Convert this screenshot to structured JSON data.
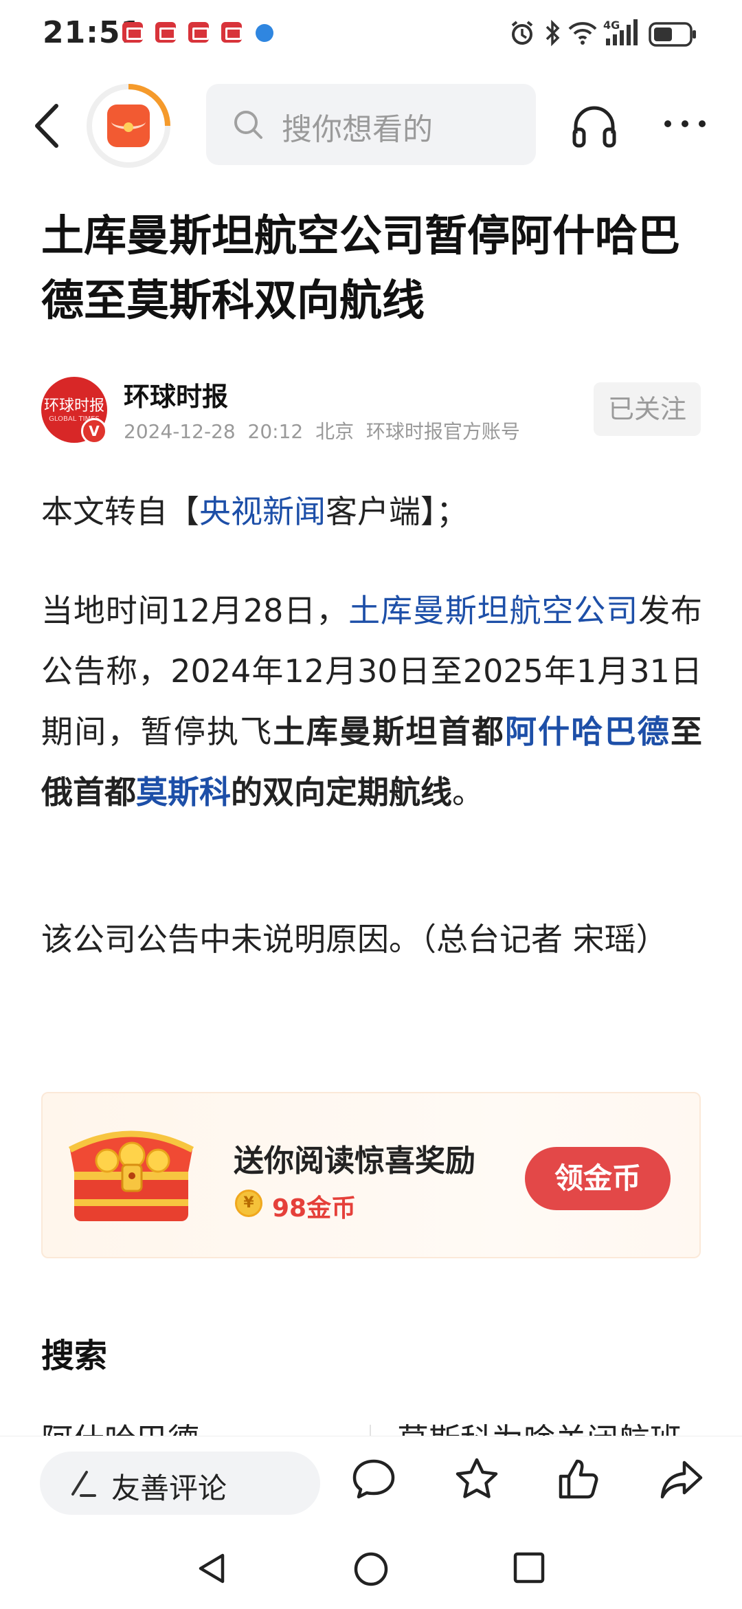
{
  "status_bar": {
    "time": "21:51",
    "icons": [
      "red-app-icon",
      "red-app-icon",
      "red-app-icon",
      "red-app-icon",
      "blue-app-icon",
      "alarm-icon",
      "bluetooth-icon",
      "wifi-icon",
      "signal-4g-icon",
      "battery-icon"
    ]
  },
  "nav": {
    "search_placeholder": "搜你想看的",
    "icons": [
      "back-icon",
      "red-packet-avatar",
      "search-icon",
      "headphones-icon",
      "more-icon"
    ]
  },
  "article": {
    "title": "土库曼斯坦航空公司暂停阿什哈巴德至莫斯科双向航线",
    "author": {
      "name": "环球时报",
      "logo_text": "环球时报",
      "logo_subtext": "GLOBAL TIMES",
      "verified_badge": "V",
      "date": "2024-12-28",
      "time": "20:12",
      "location": "北京",
      "account_type": "环球时报官方账号",
      "follow_label": "已关注"
    },
    "p1": {
      "prefix": "本文转自【",
      "link": "央视新闻",
      "suffix": "客户端】；"
    },
    "p2": {
      "prefix": "当地时间12月28日，",
      "link_airline": "土库曼斯坦航空公司",
      "middle": "发布公告称，2024年12月30日至2025年1月31日期间，暂停执飞",
      "strong1": "土库曼斯坦首都",
      "link_city1": "阿什哈巴德",
      "strong2": "至俄首都",
      "link_city2": "莫斯科",
      "strong3": "的双向定期航线",
      "end": "。"
    },
    "p3": "该公司公告中未说明原因。（总台记者 宋瑶）"
  },
  "reward": {
    "title": "送你阅读惊喜奖励",
    "coin_symbol": "¥",
    "amount": "98金币",
    "button": "领金币"
  },
  "search_section": {
    "title": "搜索",
    "suggestions": [
      "阿什哈巴德",
      "莫斯科为啥关闭航班"
    ]
  },
  "bottom_bar": {
    "comment_placeholder": "友善评论",
    "icons": [
      "comment-icon",
      "favorite-star-icon",
      "like-thumb-icon",
      "share-icon"
    ]
  },
  "system_nav": [
    "nav-back-icon",
    "nav-home-icon",
    "nav-recents-icon"
  ]
}
